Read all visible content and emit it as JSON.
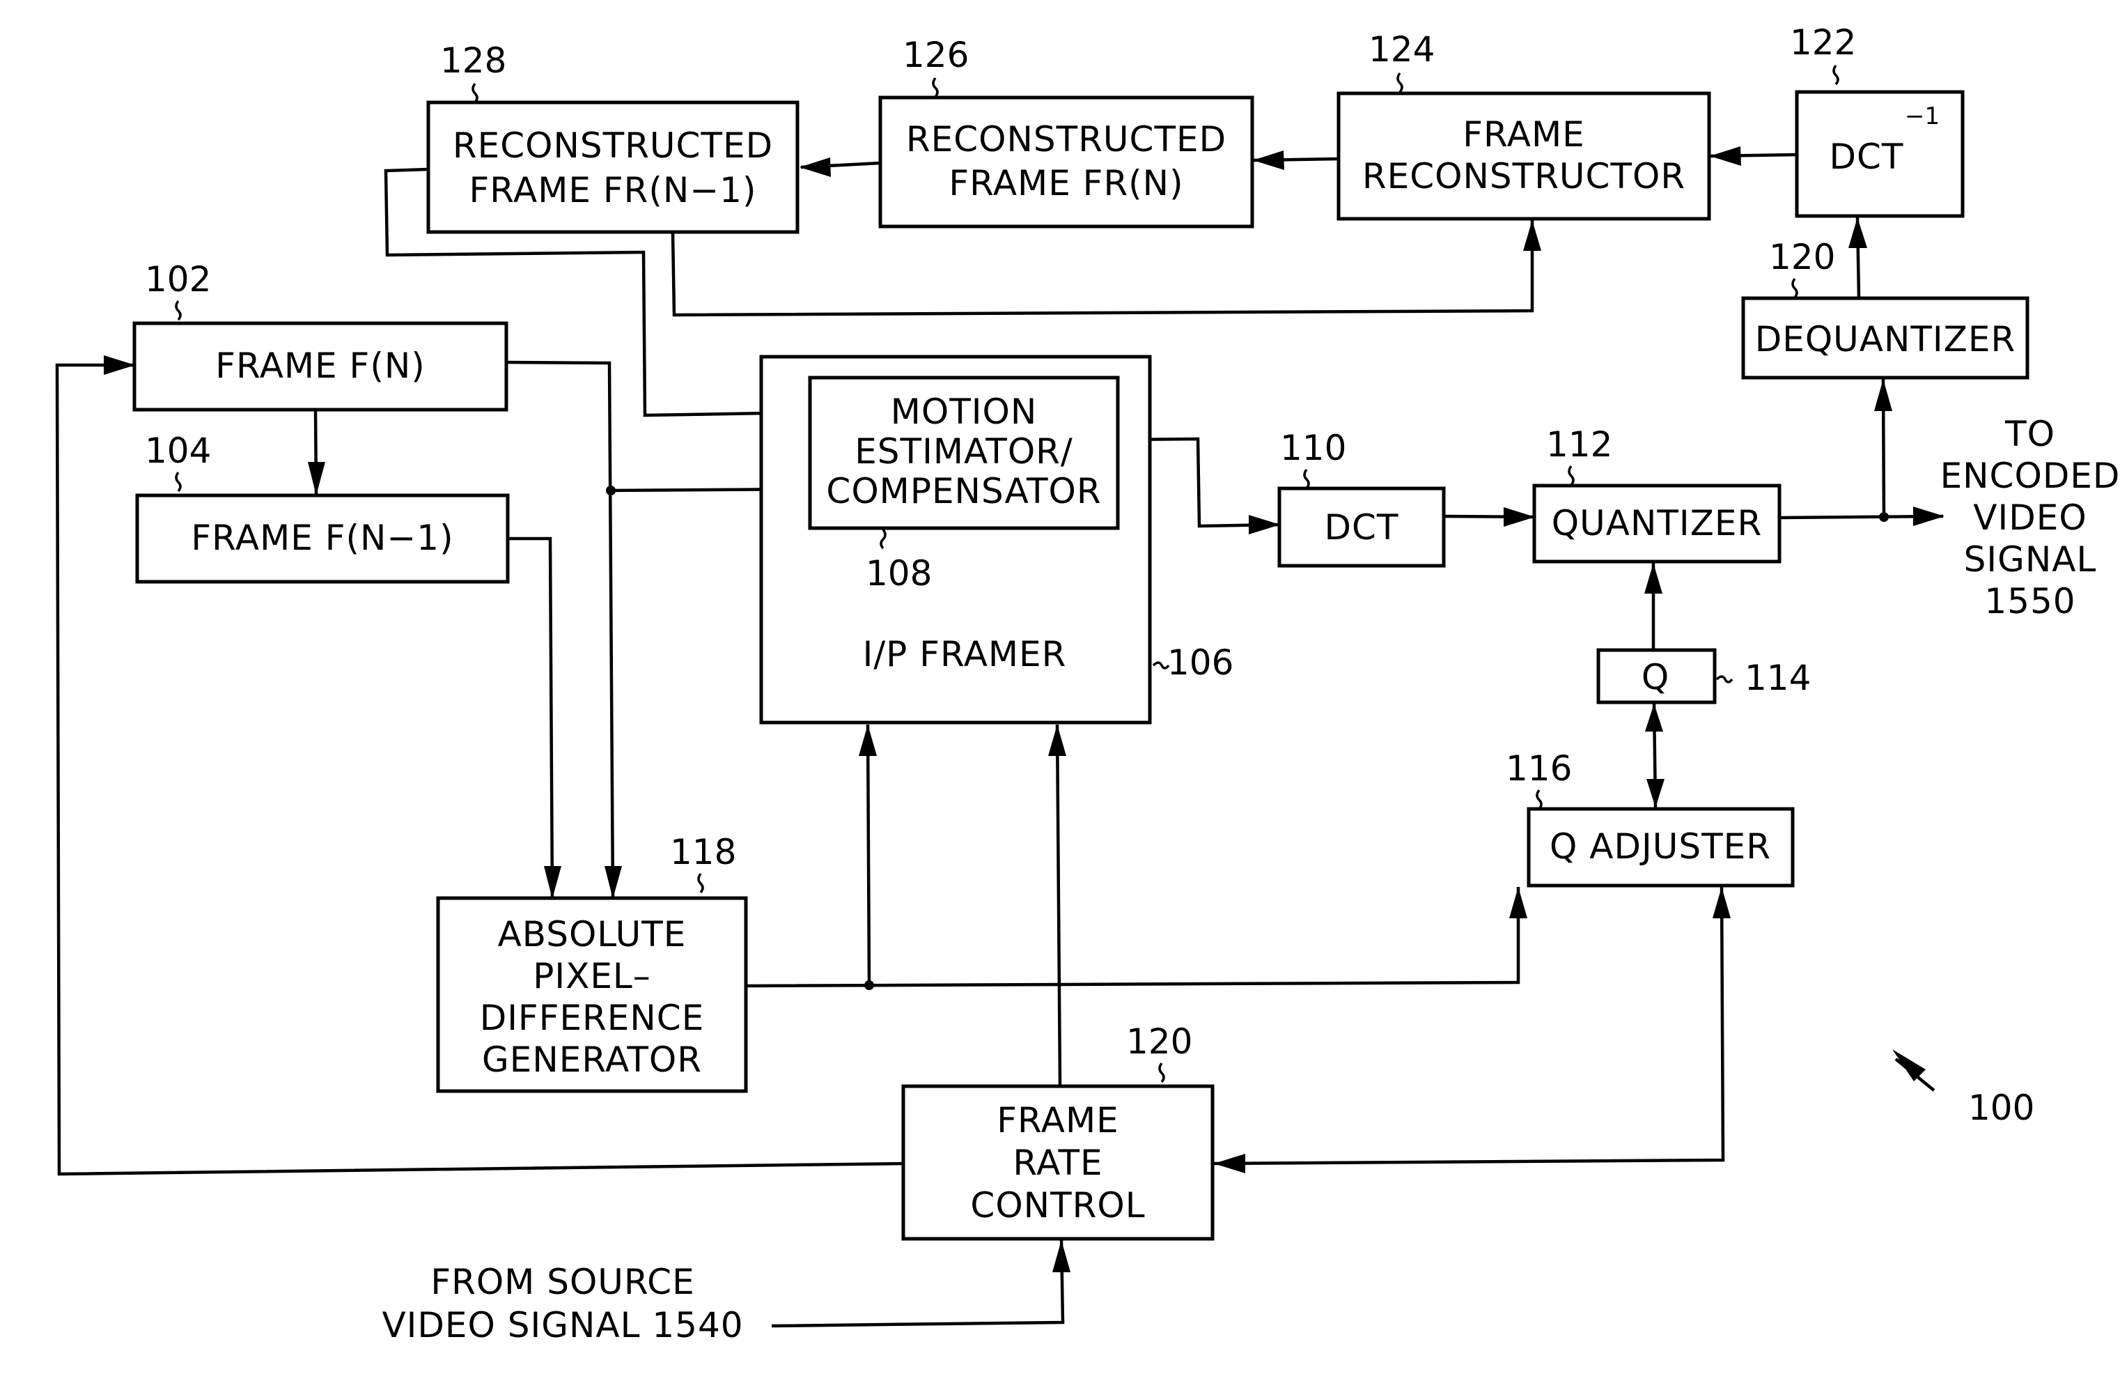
{
  "figure": {
    "reference": "100",
    "blocks": {
      "recon_prev": {
        "ref": "128",
        "lines": [
          "RECONSTRUCTED",
          "FRAME  FR(N−1)"
        ]
      },
      "recon_curr": {
        "ref": "126",
        "lines": [
          "RECONSTRUCTED",
          "FRAME  FR(N)"
        ]
      },
      "frame_reconstructor": {
        "ref": "124",
        "lines": [
          "FRAME",
          "RECONSTRUCTOR"
        ]
      },
      "inverse_dct": {
        "ref": "122",
        "label": "DCT",
        "superscript": "−1"
      },
      "dequantizer": {
        "ref": "120",
        "label": "DEQUANTIZER"
      },
      "frame_n": {
        "ref": "102",
        "label": "FRAME  F(N)"
      },
      "frame_n_1": {
        "ref": "104",
        "label": "FRAME  F(N−1)"
      },
      "ip_framer": {
        "ref": "106",
        "label": "I/P  FRAMER"
      },
      "motion": {
        "ref": "108",
        "lines": [
          "MOTION",
          "ESTIMATOR/",
          "COMPENSATOR"
        ]
      },
      "dct": {
        "ref": "110",
        "label": "DCT"
      },
      "quantizer": {
        "ref": "112",
        "label": "QUANTIZER"
      },
      "q": {
        "ref": "114",
        "label": "Q"
      },
      "q_adjuster": {
        "ref": "116",
        "label": "Q  ADJUSTER"
      },
      "abs_pixel_diff": {
        "ref": "118",
        "lines": [
          "ABSOLUTE",
          "PIXEL–",
          "DIFFERENCE",
          "GENERATOR"
        ]
      },
      "frame_rate_control": {
        "ref": "120",
        "lines": [
          "FRAME",
          "RATE",
          "CONTROL"
        ]
      }
    },
    "output_label": [
      "TO",
      "ENCODED",
      "VIDEO",
      "SIGNAL",
      "1550"
    ],
    "input_label": [
      "FROM  SOURCE",
      "VIDEO  SIGNAL  1540"
    ]
  }
}
